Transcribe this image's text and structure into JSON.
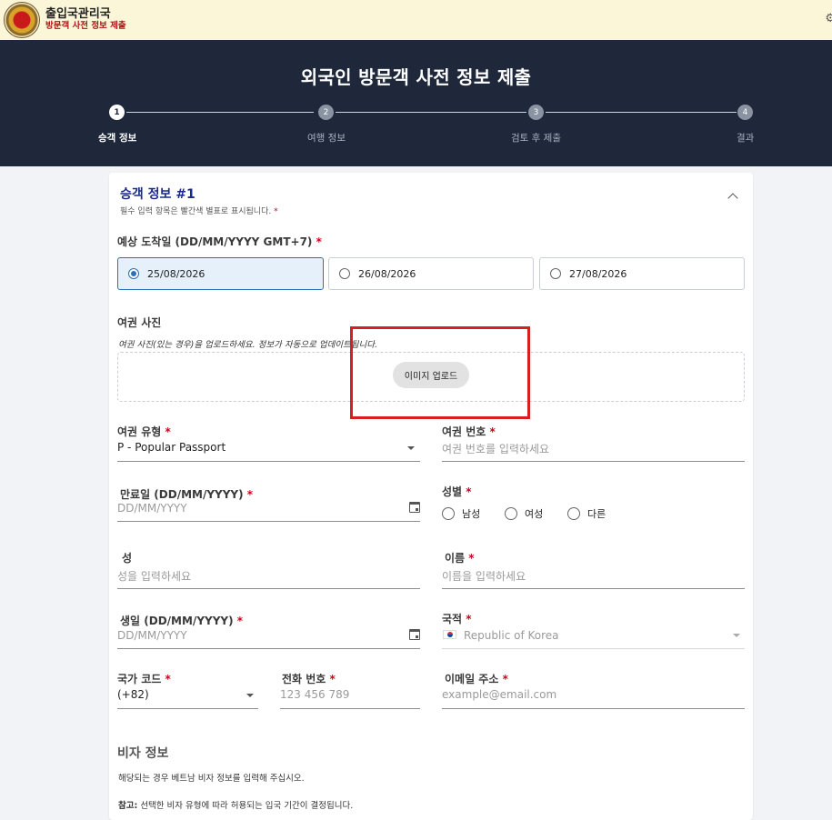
{
  "topbar": {
    "org_name": "출입국관리국",
    "org_sub": "방문객 사전 정보 제출",
    "emblem": "immigration-emblem"
  },
  "header": {
    "title": "외국인 방문객 사전 정보 제출",
    "steps": [
      {
        "num": "1",
        "label": "승객 정보"
      },
      {
        "num": "2",
        "label": "여행 정보"
      },
      {
        "num": "3",
        "label": "검토 후 제출"
      },
      {
        "num": "4",
        "label": "결과"
      }
    ],
    "current_step": 1
  },
  "form": {
    "title": "승객 정보 #1",
    "required_note": "필수 입력 항목은 빨간색 별표로 표시됩니다.",
    "arrival": {
      "label": "예상 도착일 (DD/MM/YYYY GMT+7)",
      "options": [
        "25/08/2026",
        "26/08/2026",
        "27/08/2026"
      ],
      "selected": "25/08/2026"
    },
    "passport_photo": {
      "label": "여권 사진",
      "hint": "여권 사진(있는 경우)을 업로드하세요. 정보가 자동으로 업데이트됩니다.",
      "upload_button": "이미지 업로드"
    },
    "passport_type": {
      "label": "여권 유형",
      "value": "P - Popular Passport"
    },
    "passport_number": {
      "label": "여권 번호",
      "placeholder": "여권 번호를 입력하세요"
    },
    "expiry": {
      "label": "만료일 (DD/MM/YYYY)",
      "placeholder": "DD/MM/YYYY"
    },
    "gender": {
      "label": "성별",
      "options": [
        "남성",
        "여성",
        "다른"
      ]
    },
    "last_name": {
      "label": "성",
      "placeholder": "성을 입력하세요"
    },
    "first_name": {
      "label": "이름",
      "placeholder": "이름을 입력하세요"
    },
    "birth": {
      "label": "생일 (DD/MM/YYYY)",
      "placeholder": "DD/MM/YYYY"
    },
    "nationality": {
      "label": "국적",
      "value": "Republic of Korea"
    },
    "country_code": {
      "label": "국가 코드",
      "value": "(+82)"
    },
    "phone": {
      "label": "전화 번호",
      "placeholder": "123 456 789"
    },
    "email": {
      "label": "이메일 주소",
      "placeholder": "example@email.com"
    },
    "visa": {
      "title": "비자 정보",
      "note": "해당되는 경우 베트남 비자 정보를 입력해 주십시오.",
      "ref_label": "참고:",
      "ref_text": "선택한 비자 유형에 따라 허용되는 입국 기간이 결정됩니다."
    }
  },
  "colors": {
    "header_bg": "#1e283a",
    "topbar_bg": "#fbf6d8",
    "accent_blue": "#2f6fb6",
    "required_red": "#d0021b",
    "highlight_box": "#d42020"
  }
}
